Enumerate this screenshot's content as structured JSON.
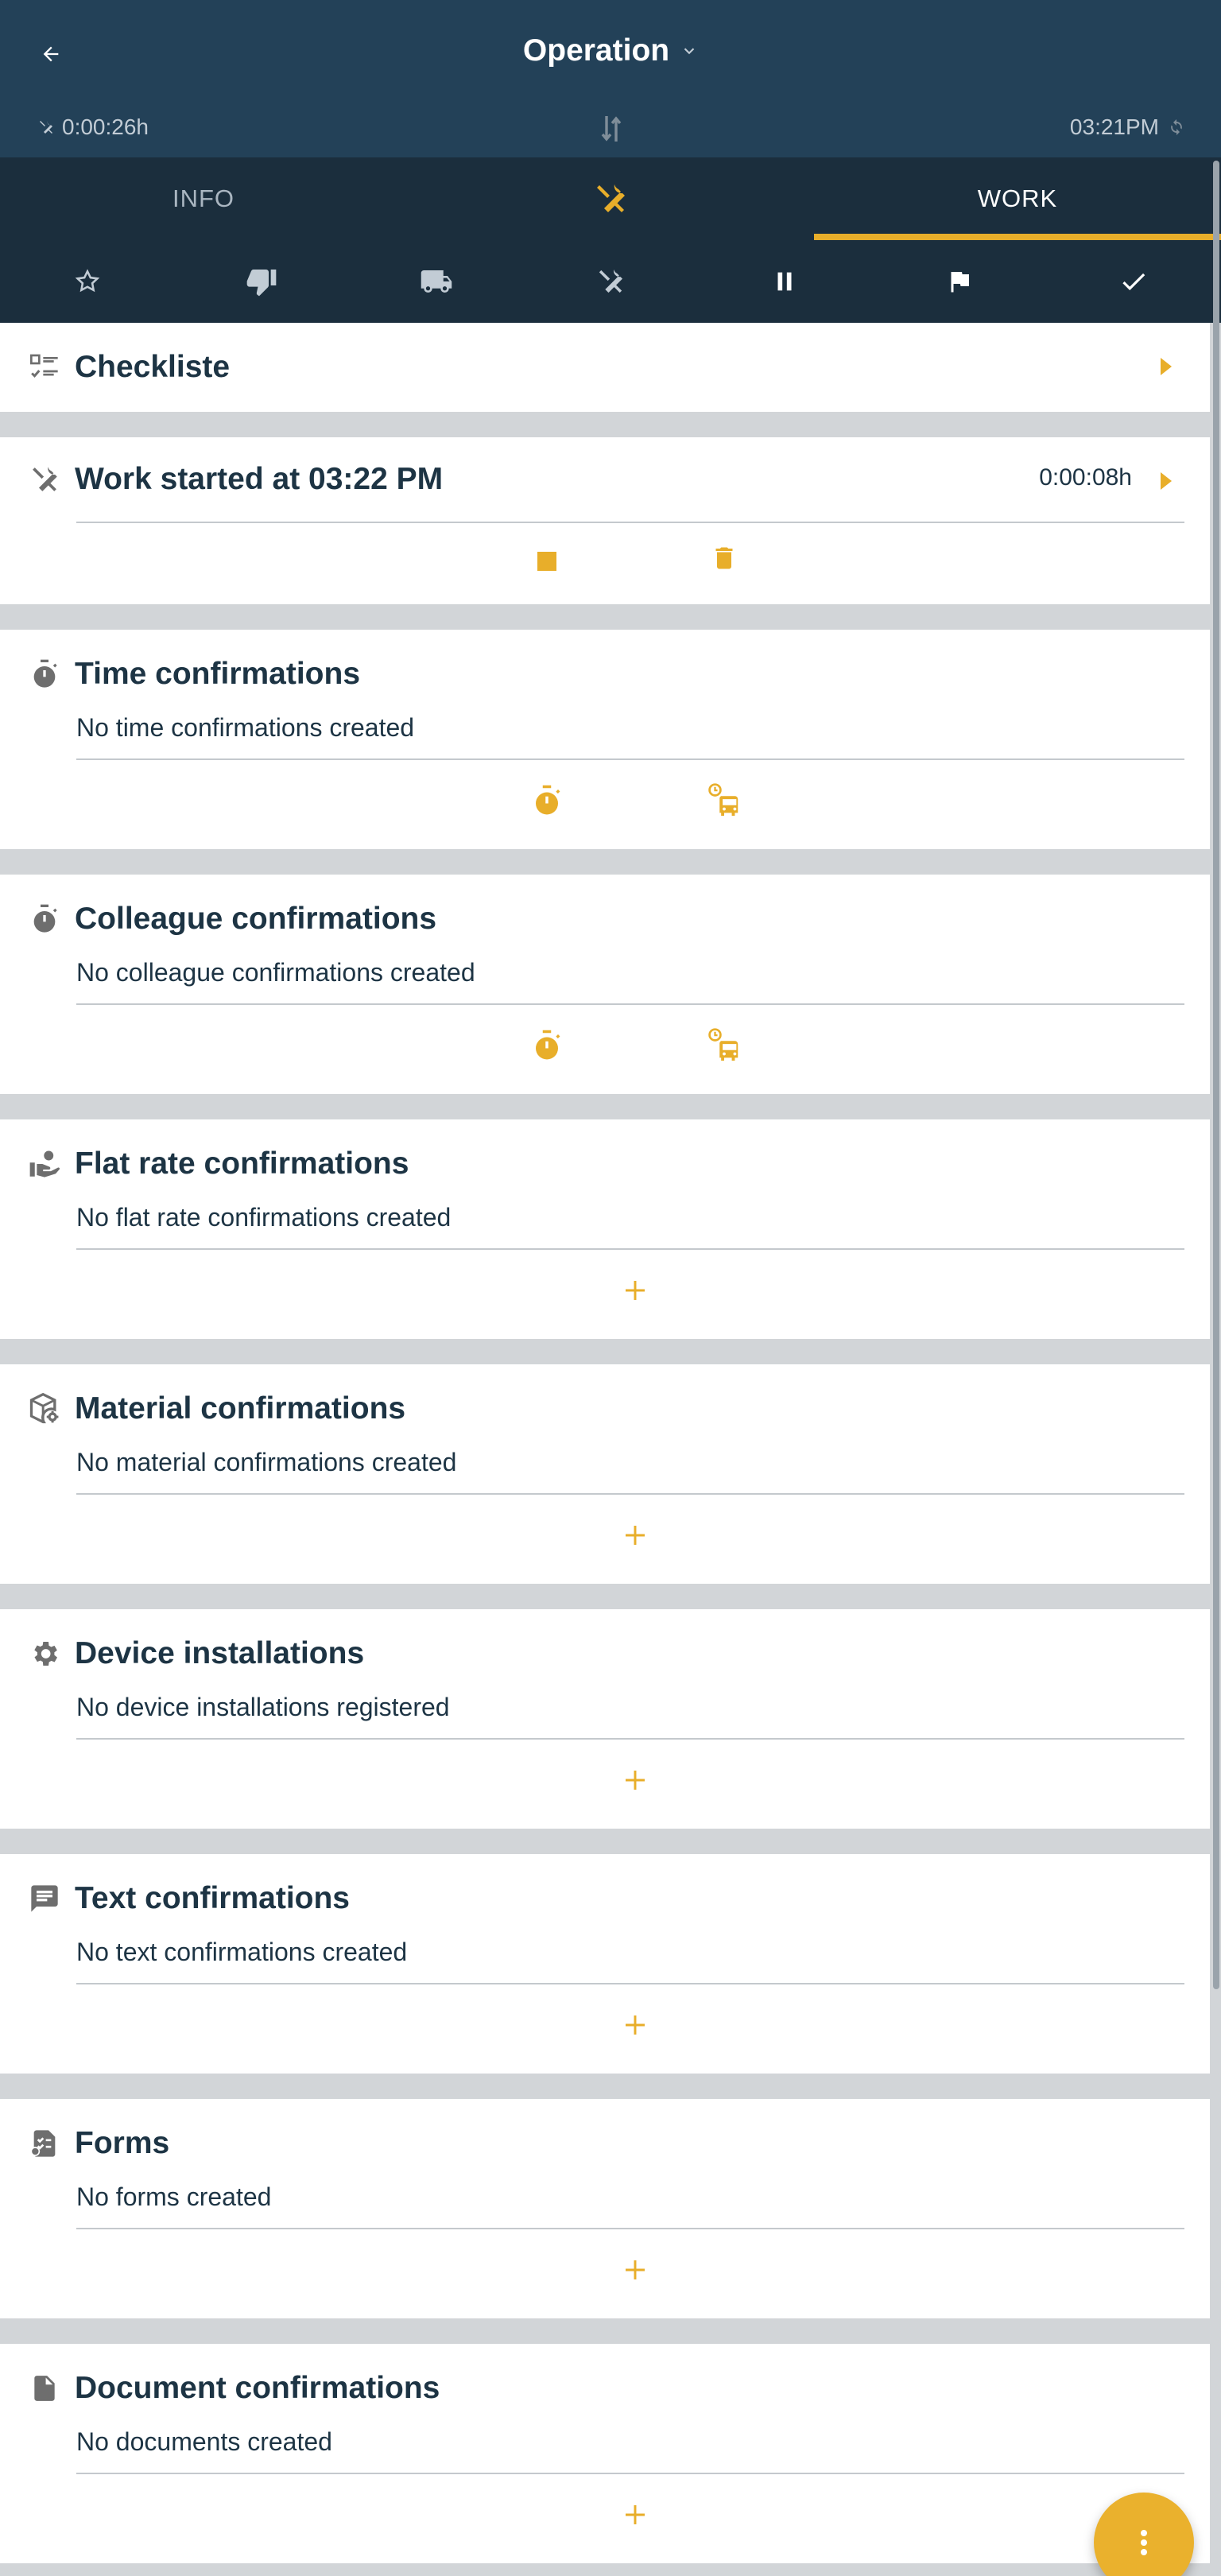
{
  "header": {
    "title": "Operation",
    "elapsed": "0:00:26h",
    "clock": "03:21PM"
  },
  "tabs": [
    {
      "label": "INFO",
      "active": false
    },
    {
      "icon": "tools-icon",
      "active": false
    },
    {
      "label": "WORK",
      "active": true
    }
  ],
  "actions": [
    "star-icon",
    "thumb-down-icon",
    "truck-icon",
    "tools-icon",
    "pause-icon",
    "flag-icon",
    "check-icon"
  ],
  "sections": {
    "checklist": {
      "title": "Checkliste"
    },
    "work": {
      "title": "Work started at 03:22 PM",
      "timer": "0:00:08h"
    },
    "time": {
      "title": "Time confirmations",
      "empty": "No time confirmations created"
    },
    "colleague": {
      "title": "Colleague confirmations",
      "empty": "No colleague confirmations created"
    },
    "flatrate": {
      "title": "Flat rate confirmations",
      "empty": "No flat rate confirmations created"
    },
    "material": {
      "title": "Material confirmations",
      "empty": "No material confirmations created"
    },
    "device": {
      "title": "Device installations",
      "empty": "No device installations registered"
    },
    "text": {
      "title": "Text confirmations",
      "empty": "No text confirmations created"
    },
    "forms": {
      "title": "Forms",
      "empty": "No forms created"
    },
    "documents": {
      "title": "Document confirmations",
      "empty": "No documents created"
    }
  },
  "colors": {
    "header": "#234158",
    "tabbar": "#1b2e3d",
    "accent": "#e8ae2a",
    "text": "#1d3444",
    "separator": "#d2d5d8"
  }
}
